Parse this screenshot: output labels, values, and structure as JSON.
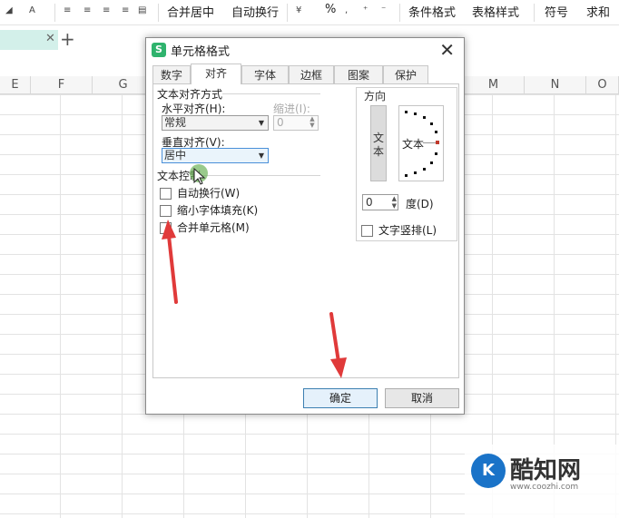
{
  "toolbar": {
    "merge_center": "合并居中",
    "auto_wrap": "自动换行",
    "percent": "%",
    "conditional_format": "条件格式",
    "table_style": "表格样式",
    "symbol": "符号",
    "sum": "求和"
  },
  "sheet": {
    "columns": [
      "E",
      "F",
      "G",
      "M",
      "N",
      "O"
    ]
  },
  "dialog": {
    "logo": "S",
    "title": "单元格格式",
    "tabs": [
      "数字",
      "对齐",
      "字体",
      "边框",
      "图案",
      "保护"
    ],
    "active_tab": "对齐",
    "text_alignment": {
      "group_title": "文本对齐方式",
      "horizontal_label": "水平对齐(H):",
      "horizontal_value": "常规",
      "indent_label": "缩进(I):",
      "indent_value": "0",
      "vertical_label": "垂直对齐(V):",
      "vertical_value": "居中"
    },
    "text_control": {
      "group_title": "文本控制",
      "wrap_text": "自动换行(W)",
      "shrink_to_fit": "缩小字体填充(K)",
      "merge_cells": "合并单元格(M)"
    },
    "orientation": {
      "group_title": "方向",
      "vertical_text": "文本",
      "dial_text": "文本",
      "degree_value": "0",
      "degree_label": "度(D)",
      "vertical_layout": "文字竖排(L)"
    },
    "ok_label": "确定",
    "cancel_label": "取消"
  },
  "watermark": {
    "logo": "K",
    "name": "酷知网",
    "url": "www.coozhi.com"
  },
  "colors": {
    "accent": "#2fb36d",
    "annotation_arrow": "#e03a3a",
    "cursor_highlight": "#7fbf6a"
  }
}
